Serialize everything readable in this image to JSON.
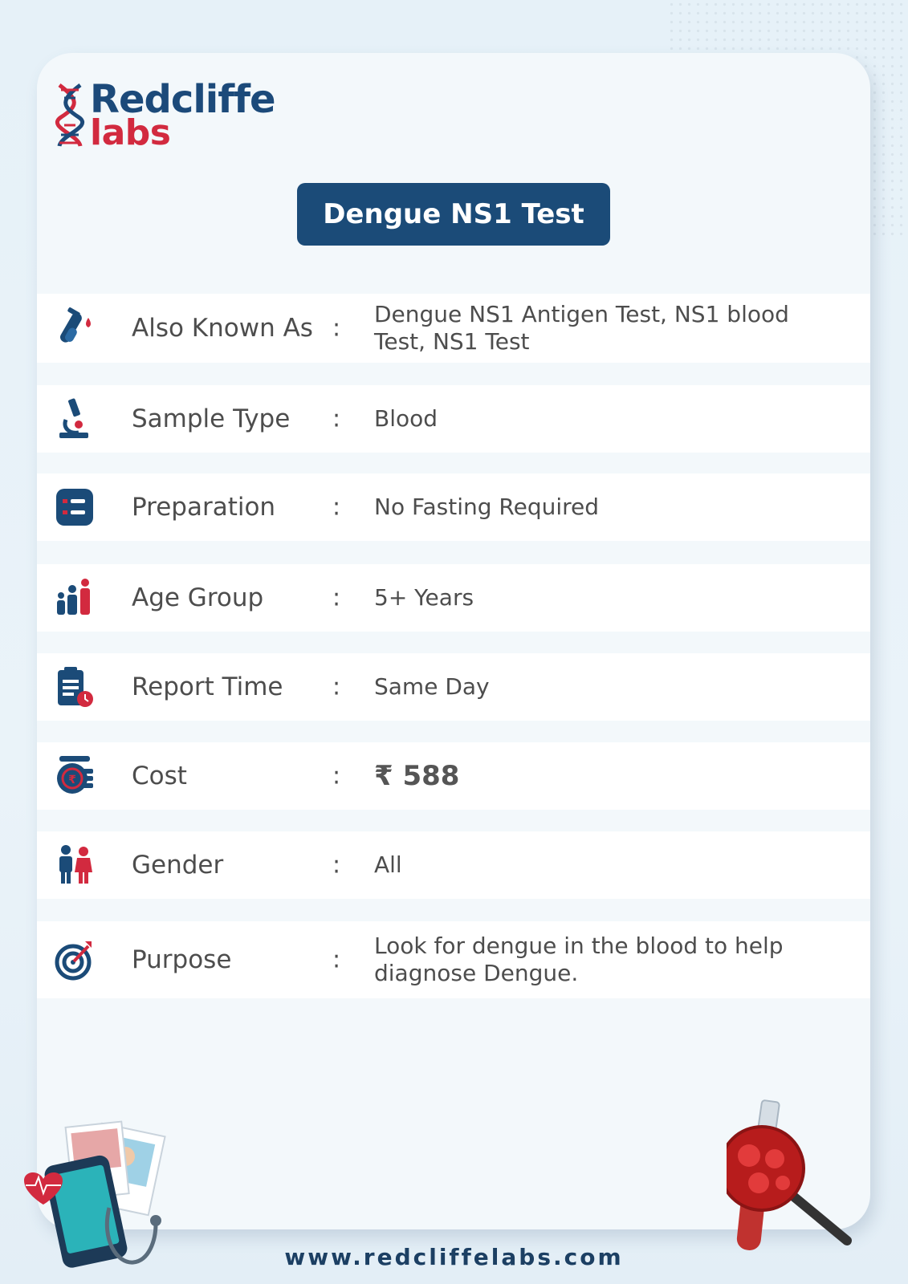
{
  "brand": {
    "line1": "Redcliffe",
    "line2": "labs",
    "primary_color": "#1b4b78",
    "accent_color": "#d22a3f"
  },
  "title": "Dengue NS1 Test",
  "rows": [
    {
      "icon": "test-tube-icon",
      "label": "Also Known As",
      "colon": ":",
      "value": "Dengue NS1 Antigen Test, NS1 blood Test, NS1 Test"
    },
    {
      "icon": "microscope-icon",
      "label": "Sample Type",
      "colon": ":",
      "value": "Blood"
    },
    {
      "icon": "checklist-icon",
      "label": "Preparation",
      "colon": ":",
      "value": "No Fasting Required"
    },
    {
      "icon": "family-icon",
      "label": "Age Group",
      "colon": ":",
      "value": "5+ Years"
    },
    {
      "icon": "report-clock-icon",
      "label": "Report Time",
      "colon": ":",
      "value": "Same Day"
    },
    {
      "icon": "rupee-coins-icon",
      "label": "Cost",
      "colon": ":",
      "value": "₹ 588"
    },
    {
      "icon": "gender-icon",
      "label": "Gender",
      "colon": ":",
      "value": "All"
    },
    {
      "icon": "target-icon",
      "label": "Purpose",
      "colon": ":",
      "value": "Look for dengue in the blood to help diagnose Dengue."
    }
  ],
  "footer": "www.redcliffelabs.com"
}
